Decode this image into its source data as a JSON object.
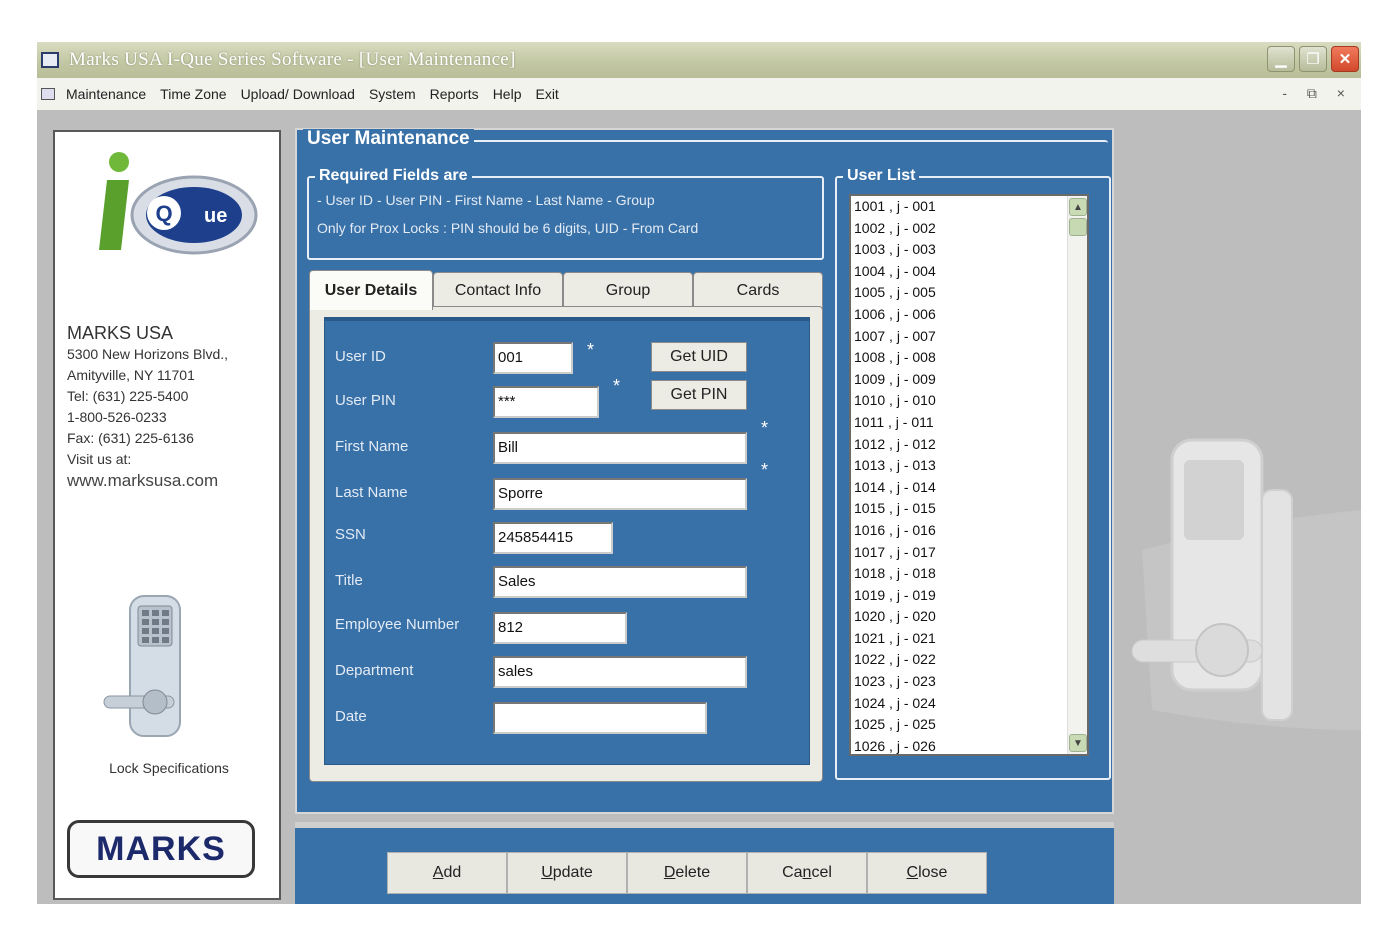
{
  "window": {
    "title": "Marks USA    I-Que Series Software - [User Maintenance]"
  },
  "menu": {
    "items": [
      "Maintenance",
      "Time Zone",
      "Upload/ Download",
      "System",
      "Reports",
      "Help",
      "Exit"
    ],
    "mdi_controls": "- ⧉ ×"
  },
  "sidebar": {
    "company_name": "MARKS USA",
    "address_lines": [
      "5300 New Horizons Blvd.,",
      "Amityville, NY 11701",
      "Tel: (631) 225-5400",
      "1-800-526-0233",
      "Fax: (631) 225-6136",
      "Visit us at:"
    ],
    "website": "www.marksusa.com",
    "lock_specifications": "Lock Specifications",
    "marks_logo": "MARKS"
  },
  "user_maintenance": {
    "group_title": "User Maintenance",
    "required": {
      "title": "Required Fields are",
      "line1": "- User ID   - User PIN   - First Name  - Last Name  - Group",
      "line2": "Only for Prox Locks : PIN should be 6 digits, UID - From Card"
    },
    "tabs": [
      "User Details",
      "Contact Info",
      "Group",
      "Cards"
    ],
    "active_tab": "User Details",
    "fields": {
      "user_id": {
        "label": "User ID",
        "value": "001"
      },
      "user_pin": {
        "label": "User PIN",
        "value": "***"
      },
      "first_name": {
        "label": "First Name",
        "value": "Bill"
      },
      "last_name": {
        "label": "Last Name",
        "value": "Sporre"
      },
      "ssn": {
        "label": "SSN",
        "value": "245854415"
      },
      "title": {
        "label": "Title",
        "value": "Sales"
      },
      "employee_number": {
        "label": "Employee Number",
        "value": "812"
      },
      "department": {
        "label": "Department",
        "value": "sales"
      },
      "date": {
        "label": "Date",
        "value": ""
      }
    },
    "required_marker": "*",
    "buttons": {
      "get_uid": "Get UID",
      "get_pin": "Get PIN"
    }
  },
  "user_list": {
    "title": "User List",
    "items": [
      "1001 , j - 001",
      "1002 , j - 002",
      "1003 , j - 003",
      "1004 , j - 004",
      "1005 , j - 005",
      "1006 , j - 006",
      "1007 , j - 007",
      "1008 , j - 008",
      "1009 , j - 009",
      "1010 , j - 010",
      "1011 , j - 011",
      "1012 , j - 012",
      "1013 , j - 013",
      "1014 , j - 014",
      "1015 , j - 015",
      "1016 , j - 016",
      "1017 , j - 017",
      "1018 , j - 018",
      "1019 , j - 019",
      "1020 , j - 020",
      "1021 , j - 021",
      "1022 , j - 022",
      "1023 , j - 023",
      "1024 , j - 024",
      "1025 , j - 025",
      "1026 , j - 026"
    ]
  },
  "actions": {
    "add": {
      "pre": "",
      "key": "A",
      "post": "dd"
    },
    "update": {
      "pre": "",
      "key": "U",
      "post": "pdate"
    },
    "delete": {
      "pre": "",
      "key": "D",
      "post": "elete"
    },
    "cancel": {
      "pre": "Ca",
      "key": "n",
      "post": "cel"
    },
    "close": {
      "pre": "",
      "key": "C",
      "post": "lose"
    }
  },
  "colors": {
    "panel_blue": "#3870a8",
    "title_bar": "#c3c8a4",
    "close_red": "#d2492c"
  },
  "icons": [
    "app-window-icon",
    "minimize-icon",
    "maximize-icon",
    "close-icon",
    "mdi-document-icon",
    "scroll-up-icon",
    "scroll-down-icon"
  ]
}
